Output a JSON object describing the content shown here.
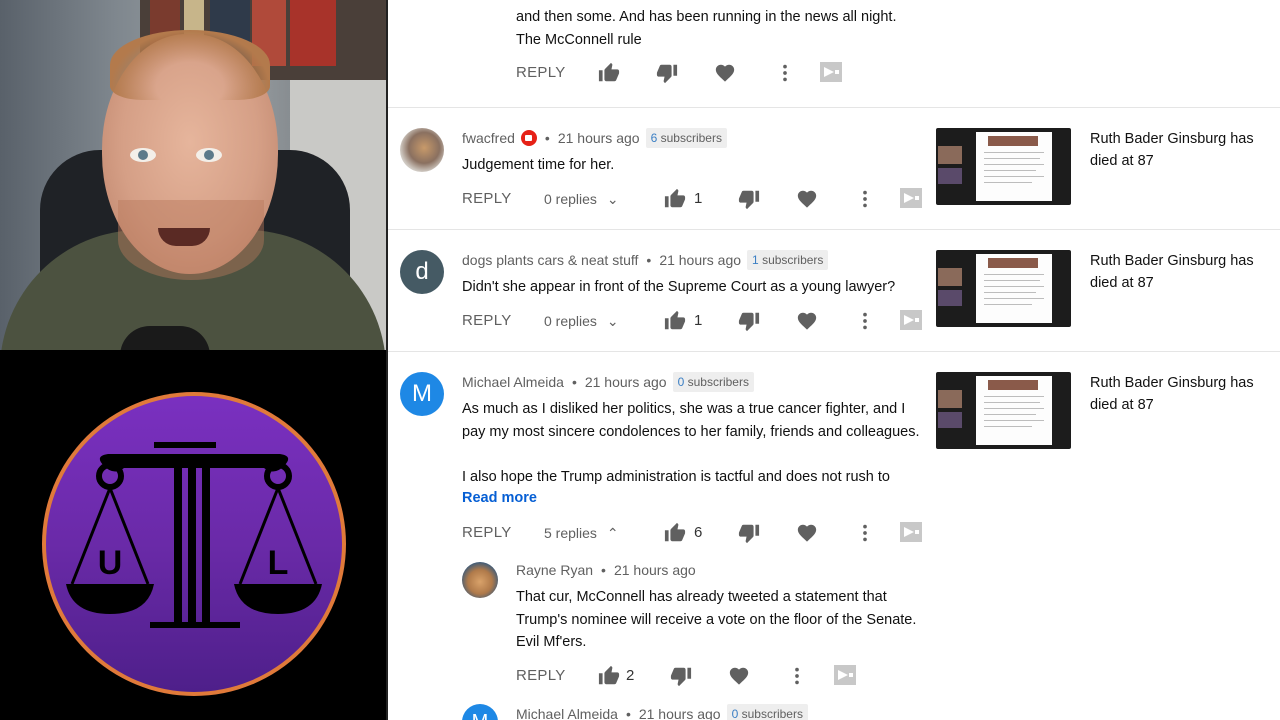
{
  "colors": {
    "link": "#065fd4",
    "meta": "#606060",
    "logo_ring": "#e07a3a",
    "logo_fill": "#6a2aa8"
  },
  "logo": {
    "left_letter": "U",
    "right_letter": "L"
  },
  "common": {
    "reply_label": "REPLY",
    "video_title_line1": "Ruth Bader Ginsburg has",
    "video_title_line2": "died at 87"
  },
  "top_reply": {
    "lines": [
      "and then some. And has been running in the news all night.",
      "The McConnell rule"
    ]
  },
  "comments": [
    {
      "author": "fwacfred",
      "time": "21 hours ago",
      "subs_count": "6",
      "subs_label": "subscribers",
      "text": "Judgement time for her.",
      "replies": "0 replies",
      "likes": "1"
    },
    {
      "author": "dogs plants cars & neat stuff",
      "time": "21 hours ago",
      "subs_count": "1",
      "subs_label": "subscribers",
      "avatar_letter": "d",
      "text": "Didn't  she appear in front of the Supreme Court as a young lawyer?",
      "replies": "0 replies",
      "likes": "1"
    },
    {
      "author": "Michael Almeida",
      "time": "21 hours ago",
      "subs_count": "0",
      "subs_label": "subscribers",
      "avatar_letter": "M",
      "text_line1": "As much as I disliked her politics, she was a true cancer fighter, and I",
      "text_line2": "pay my most sincere condolences to her family, friends and colleagues.",
      "text_line3": "I also hope the Trump administration is tactful and does not rush to",
      "read_more": "Read more",
      "replies": "5 replies",
      "likes": "6"
    }
  ],
  "nested_reply": {
    "author": "Rayne Ryan",
    "time": "21 hours ago",
    "line1": "That cur, McConnell has already tweeted a statement that",
    "line2": "Trump's nominee  will receive a vote on the floor of the Senate.",
    "line3": "Evil Mf'ers.",
    "likes": "2"
  },
  "nested_reply_2": {
    "author": "Michael Almeida",
    "time": "21 hours ago",
    "subs_count": "0",
    "subs_label": "subscribers",
    "avatar_letter": "M"
  }
}
